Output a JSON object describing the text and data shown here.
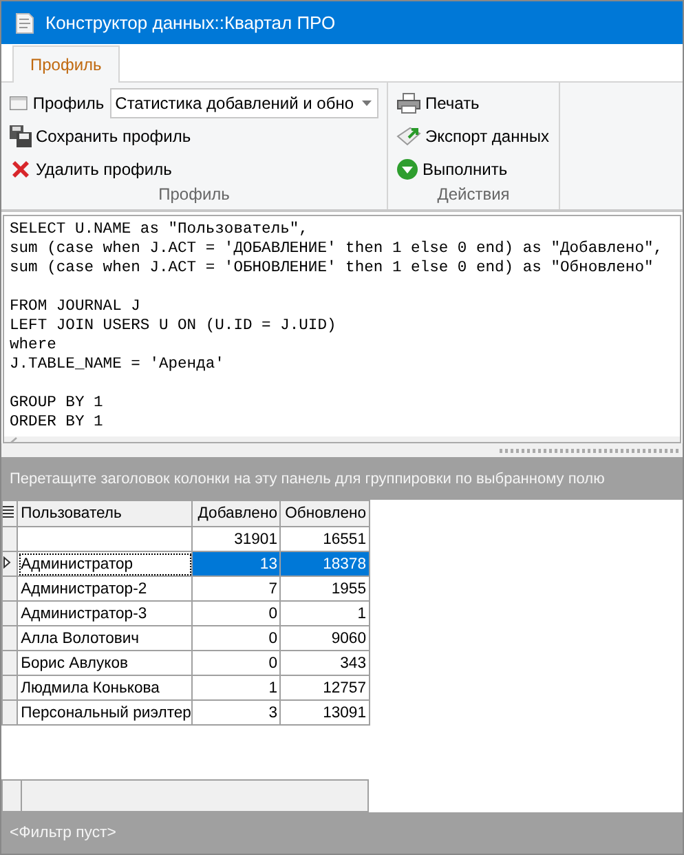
{
  "window": {
    "title": "Конструктор данных::Квартал ПРО"
  },
  "tabs": [
    {
      "label": "Профиль",
      "selected": true
    }
  ],
  "ribbon": {
    "groups": [
      {
        "label": "Профиль",
        "items": [
          {
            "kind": "combo",
            "label": "Профиль",
            "value": "Статистика добавлений и обно"
          },
          {
            "kind": "button",
            "label": "Сохранить профиль"
          },
          {
            "kind": "button",
            "label": "Удалить профиль"
          }
        ]
      },
      {
        "label": "Действия",
        "items": [
          {
            "kind": "button",
            "label": "Печать"
          },
          {
            "kind": "button",
            "label": "Экспорт данных"
          },
          {
            "kind": "button",
            "label": "Выполнить"
          }
        ]
      }
    ]
  },
  "sql": "SELECT U.NAME as \"Пользователь\",\nsum (case when J.ACT = 'ДОБАВЛЕНИЕ' then 1 else 0 end) as \"Добавлено\",\nsum (case when J.ACT = 'ОБНОВЛЕНИЕ' then 1 else 0 end) as \"Обновлено\"\n\nFROM JOURNAL J\nLEFT JOIN USERS U ON (U.ID = J.UID)\nwhere\nJ.TABLE_NAME = 'Аренда'\n\nGROUP BY 1\nORDER BY 1",
  "group_panel": "Перетащите заголовок колонки на эту панель для группировки по выбранному полю",
  "table": {
    "columns": [
      "Пользователь",
      "Добавлено",
      "Обновлено"
    ],
    "totals": [
      "31901",
      "16551"
    ],
    "rows": [
      {
        "cells": [
          "Администратор",
          "13",
          "18378"
        ],
        "selected": true
      },
      {
        "cells": [
          "Администратор-2",
          "7",
          "1955"
        ],
        "selected": false
      },
      {
        "cells": [
          "Администратор-3",
          "0",
          "1"
        ],
        "selected": false
      },
      {
        "cells": [
          "Алла Волотович",
          "0",
          "9060"
        ],
        "selected": false
      },
      {
        "cells": [
          "Борис Авлуков",
          "0",
          "343"
        ],
        "selected": false
      },
      {
        "cells": [
          "Людмила Конькова",
          "1",
          "12757"
        ],
        "selected": false
      },
      {
        "cells": [
          "Персональный риэлтер",
          "3",
          "13091"
        ],
        "selected": false
      }
    ]
  },
  "filter_bar": "<Фильтр пуст>"
}
